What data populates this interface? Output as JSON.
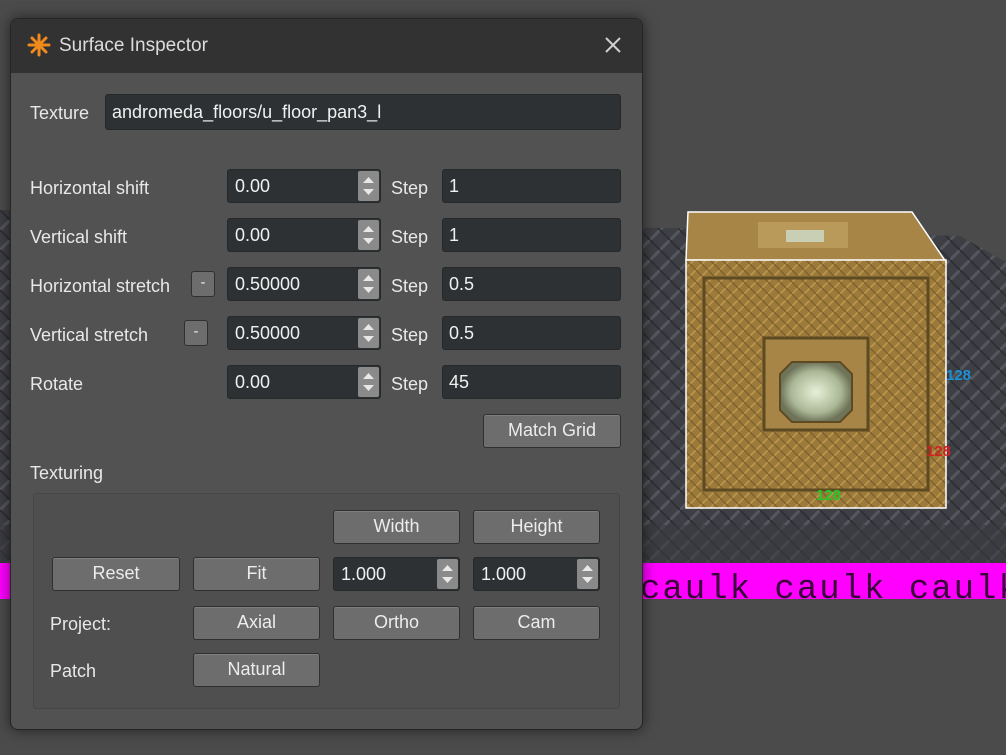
{
  "window": {
    "title": "Surface Inspector"
  },
  "texture": {
    "label": "Texture",
    "value": "andromeda_floors/u_floor_pan3_l"
  },
  "rows": [
    {
      "label": "Horizontal shift",
      "value": "0.00",
      "step_label": "Step",
      "step": "1",
      "has_minus": false
    },
    {
      "label": "Vertical shift",
      "value": "0.00",
      "step_label": "Step",
      "step": "1",
      "has_minus": false
    },
    {
      "label": "Horizontal stretch",
      "value": "0.50000",
      "step_label": "Step",
      "step": "0.5",
      "has_minus": true
    },
    {
      "label": "Vertical stretch",
      "value": "0.50000",
      "step_label": "Step",
      "step": "0.5",
      "has_minus": true
    },
    {
      "label": "Rotate",
      "value": "0.00",
      "step_label": "Step",
      "step": "45",
      "has_minus": false
    }
  ],
  "minus_label": "-",
  "match_grid": "Match Grid",
  "texturing": {
    "heading": "Texturing",
    "width_label": "Width",
    "height_label": "Height",
    "reset": "Reset",
    "fit": "Fit",
    "width_value": "1.000",
    "height_value": "1.000",
    "project_label": "Project:",
    "axial": "Axial",
    "ortho": "Ortho",
    "cam": "Cam",
    "patch_label": "Patch",
    "natural": "Natural"
  },
  "viewport": {
    "dim_blue": "128",
    "dim_red": "128",
    "dim_green": "128",
    "caulk_text": "caulk caulk caulk c"
  },
  "colors": {
    "accent_orange": "#f08a1c",
    "caulk_magenta": "#ff00ff",
    "dim_blue": "#1e90d8",
    "dim_red": "#d02020",
    "dim_green": "#28c828"
  }
}
